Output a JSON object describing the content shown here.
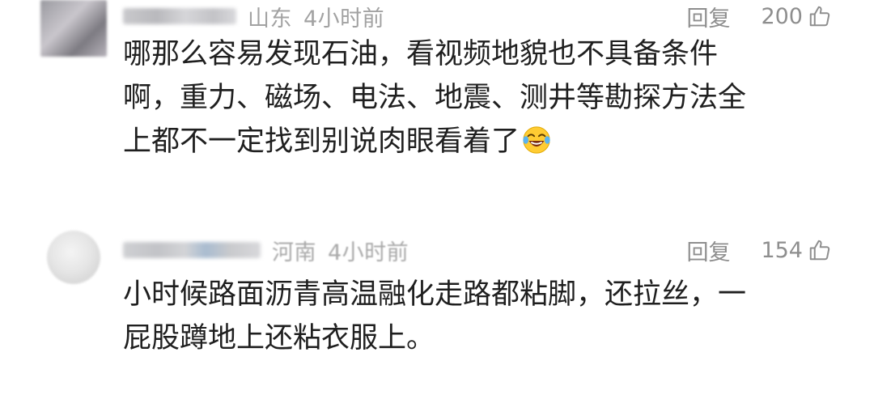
{
  "comments": [
    {
      "location": "山东",
      "time": "4小时前",
      "reply_label": "回复",
      "likes": "200",
      "lines": [
        "哪那么容易发现石油，看视频地貌也不具备条件",
        "啊，重力、磁场、电法、地震、测井等勘探方法全",
        "上都不一定找到别说肉眼看着了"
      ],
      "trailing_emoji": "laughing-tears-emoji"
    },
    {
      "location": "河南",
      "time": "4小时前",
      "reply_label": "回复",
      "likes": "154",
      "lines": [
        "小时候路面沥青高温融化走路都粘脚，还拉丝，一",
        "屁股蹲地上还粘衣服上。"
      ]
    }
  ],
  "colors": {
    "text": "#1f1f1f",
    "meta": "#a2a2a2",
    "action": "#8e8e8e",
    "background": "#ffffff"
  }
}
